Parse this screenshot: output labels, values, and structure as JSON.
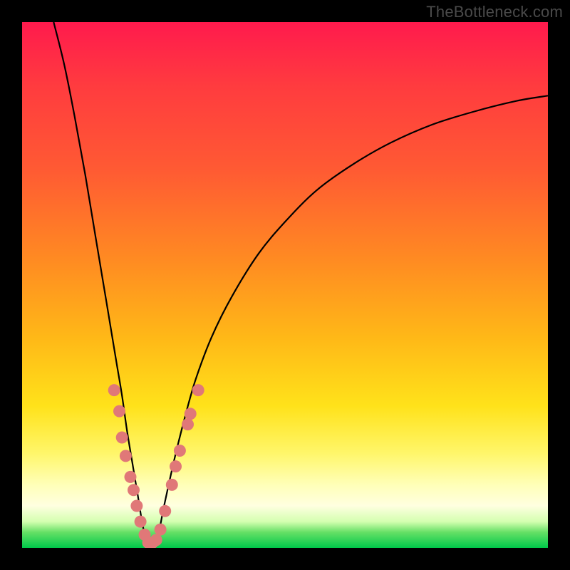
{
  "watermark": "TheBottleneck.com",
  "colors": {
    "frame": "#000000",
    "curve_stroke": "#000000",
    "marker_fill": "#e07878",
    "marker_stroke": "#d86a6a"
  },
  "chart_data": {
    "type": "line",
    "title": "",
    "xlabel": "",
    "ylabel": "",
    "xlim": [
      0,
      100
    ],
    "ylim": [
      0,
      100
    ],
    "note": "Axes are unlabeled; x/y values are pixel-fraction estimates (0–100) read off the image. The curve is a V-shaped bottleneck curve touching y≈0 near x≈24.",
    "series": [
      {
        "name": "bottleneck-curve",
        "points": [
          {
            "x": 6.0,
            "y": 100.0
          },
          {
            "x": 8.0,
            "y": 92.0
          },
          {
            "x": 10.0,
            "y": 82.0
          },
          {
            "x": 12.0,
            "y": 71.0
          },
          {
            "x": 14.0,
            "y": 59.0
          },
          {
            "x": 16.0,
            "y": 47.0
          },
          {
            "x": 18.0,
            "y": 35.0
          },
          {
            "x": 19.0,
            "y": 29.0
          },
          {
            "x": 20.0,
            "y": 22.0
          },
          {
            "x": 21.0,
            "y": 16.0
          },
          {
            "x": 22.0,
            "y": 10.0
          },
          {
            "x": 23.0,
            "y": 4.0
          },
          {
            "x": 24.0,
            "y": 0.5
          },
          {
            "x": 25.0,
            "y": 0.5
          },
          {
            "x": 26.0,
            "y": 3.0
          },
          {
            "x": 27.0,
            "y": 8.0
          },
          {
            "x": 29.0,
            "y": 17.0
          },
          {
            "x": 31.0,
            "y": 25.0
          },
          {
            "x": 33.0,
            "y": 32.0
          },
          {
            "x": 36.0,
            "y": 40.0
          },
          {
            "x": 40.0,
            "y": 48.0
          },
          {
            "x": 45.0,
            "y": 56.0
          },
          {
            "x": 50.0,
            "y": 62.0
          },
          {
            "x": 56.0,
            "y": 68.0
          },
          {
            "x": 63.0,
            "y": 73.0
          },
          {
            "x": 70.0,
            "y": 77.0
          },
          {
            "x": 78.0,
            "y": 80.5
          },
          {
            "x": 86.0,
            "y": 83.0
          },
          {
            "x": 94.0,
            "y": 85.0
          },
          {
            "x": 100.0,
            "y": 86.0
          }
        ]
      }
    ],
    "markers": {
      "name": "highlighted-points",
      "note": "Salmon-pink dots clustered around the V bottom; values are pixel-fraction estimates.",
      "points": [
        {
          "x": 17.5,
          "y": 30.0
        },
        {
          "x": 18.5,
          "y": 26.0
        },
        {
          "x": 19.0,
          "y": 21.0
        },
        {
          "x": 19.7,
          "y": 17.5
        },
        {
          "x": 20.6,
          "y": 13.5
        },
        {
          "x": 21.2,
          "y": 11.0
        },
        {
          "x": 21.8,
          "y": 8.0
        },
        {
          "x": 22.5,
          "y": 5.0
        },
        {
          "x": 23.3,
          "y": 2.5
        },
        {
          "x": 24.0,
          "y": 1.0
        },
        {
          "x": 24.8,
          "y": 1.0
        },
        {
          "x": 25.5,
          "y": 1.5
        },
        {
          "x": 26.3,
          "y": 3.5
        },
        {
          "x": 27.2,
          "y": 7.0
        },
        {
          "x": 28.5,
          "y": 12.0
        },
        {
          "x": 29.2,
          "y": 15.5
        },
        {
          "x": 30.0,
          "y": 18.5
        },
        {
          "x": 31.5,
          "y": 23.5
        },
        {
          "x": 32.0,
          "y": 25.5
        },
        {
          "x": 33.5,
          "y": 30.0
        }
      ]
    }
  }
}
